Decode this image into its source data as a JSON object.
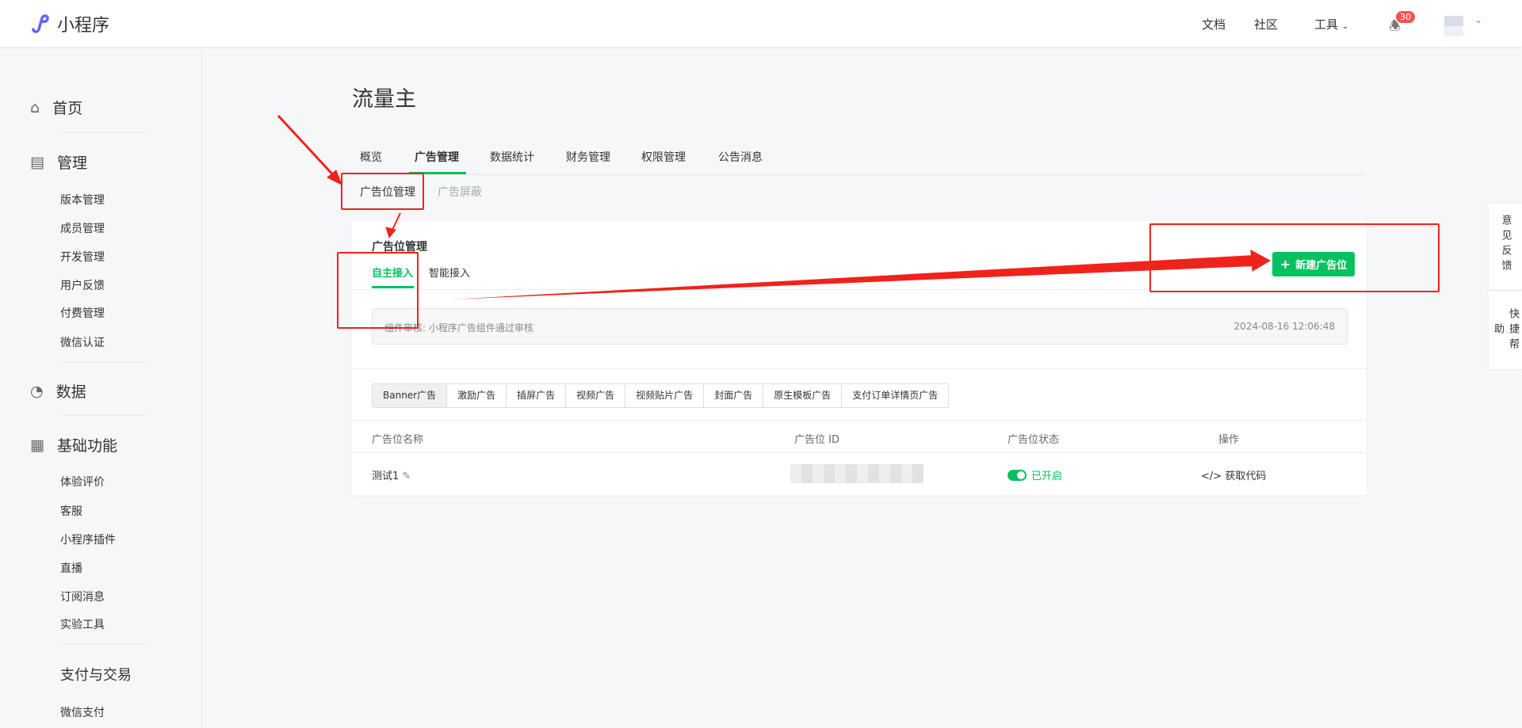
{
  "header": {
    "app_name": "小程序",
    "nav": [
      "文档",
      "社区",
      "工具"
    ],
    "notification_count": "30"
  },
  "sidebar": {
    "home": "首页",
    "manage": {
      "label": "管理",
      "items": [
        "版本管理",
        "成员管理",
        "开发管理",
        "用户反馈",
        "付费管理",
        "微信认证"
      ]
    },
    "data": "数据",
    "basic": {
      "label": "基础功能",
      "items": [
        "体验评价",
        "客服",
        "小程序插件",
        "直播",
        "订阅消息",
        "实验工具"
      ]
    },
    "pay": {
      "label": "支付与交易",
      "items": [
        "微信支付"
      ]
    }
  },
  "page": {
    "title": "流量主",
    "tabs": [
      "概览",
      "广告管理",
      "数据统计",
      "财务管理",
      "权限管理",
      "公告消息"
    ],
    "active_tab": "广告管理",
    "subtabs": [
      "广告位管理",
      "广告屏蔽"
    ]
  },
  "card": {
    "title": "广告位管理",
    "inner_tabs": [
      "自主接入",
      "智能接入"
    ],
    "new_button": "新建广告位",
    "notice": {
      "text": "组件审核: 小程序广告组件通过审核",
      "time": "2024-08-16 12:06:48"
    },
    "ad_types": [
      "Banner广告",
      "激励广告",
      "插屏广告",
      "视频广告",
      "视频贴片广告",
      "封面广告",
      "原生模板广告",
      "支付订单详情页广告"
    ],
    "columns": [
      "广告位名称",
      "广告位 ID",
      "广告位状态",
      "操作"
    ],
    "rows": [
      {
        "name": "测试1",
        "status": "已开启",
        "action": "获取代码"
      }
    ]
  },
  "floating": [
    "意见反馈",
    "快捷帮助"
  ],
  "colors": {
    "accent": "#07c160",
    "annotation": "#f0231c"
  }
}
